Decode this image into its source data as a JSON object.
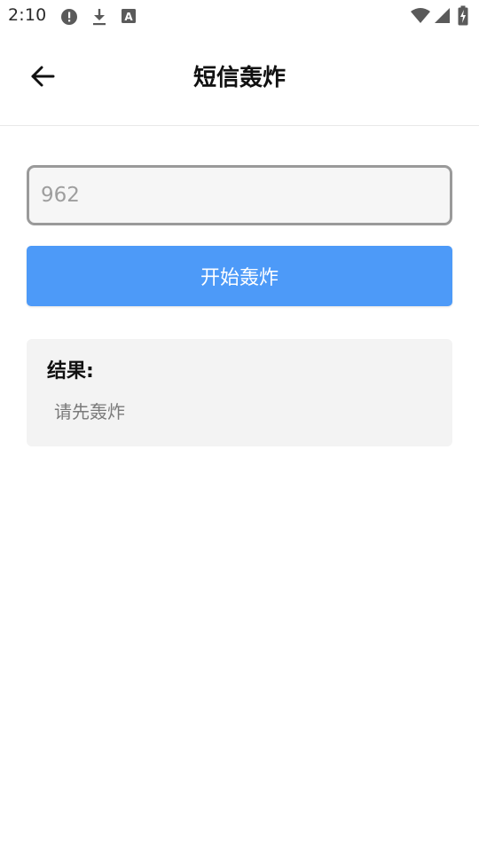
{
  "status_bar": {
    "time": "2:10",
    "left_icons": [
      "alert-icon",
      "download-icon",
      "a-box-icon"
    ],
    "right_icons": [
      "wifi-icon",
      "cell-signal-icon",
      "battery-charging-icon"
    ]
  },
  "app_bar": {
    "back_icon": "arrow-left-icon",
    "title": "短信轰炸"
  },
  "form": {
    "phone_value": "962",
    "start_button_label": "开始轰炸"
  },
  "result": {
    "heading": "结果:",
    "text": "请先轰炸"
  },
  "colors": {
    "accent": "#4d9af8",
    "card_bg": "#f3f3f3",
    "input_border": "#9a9a9a"
  }
}
